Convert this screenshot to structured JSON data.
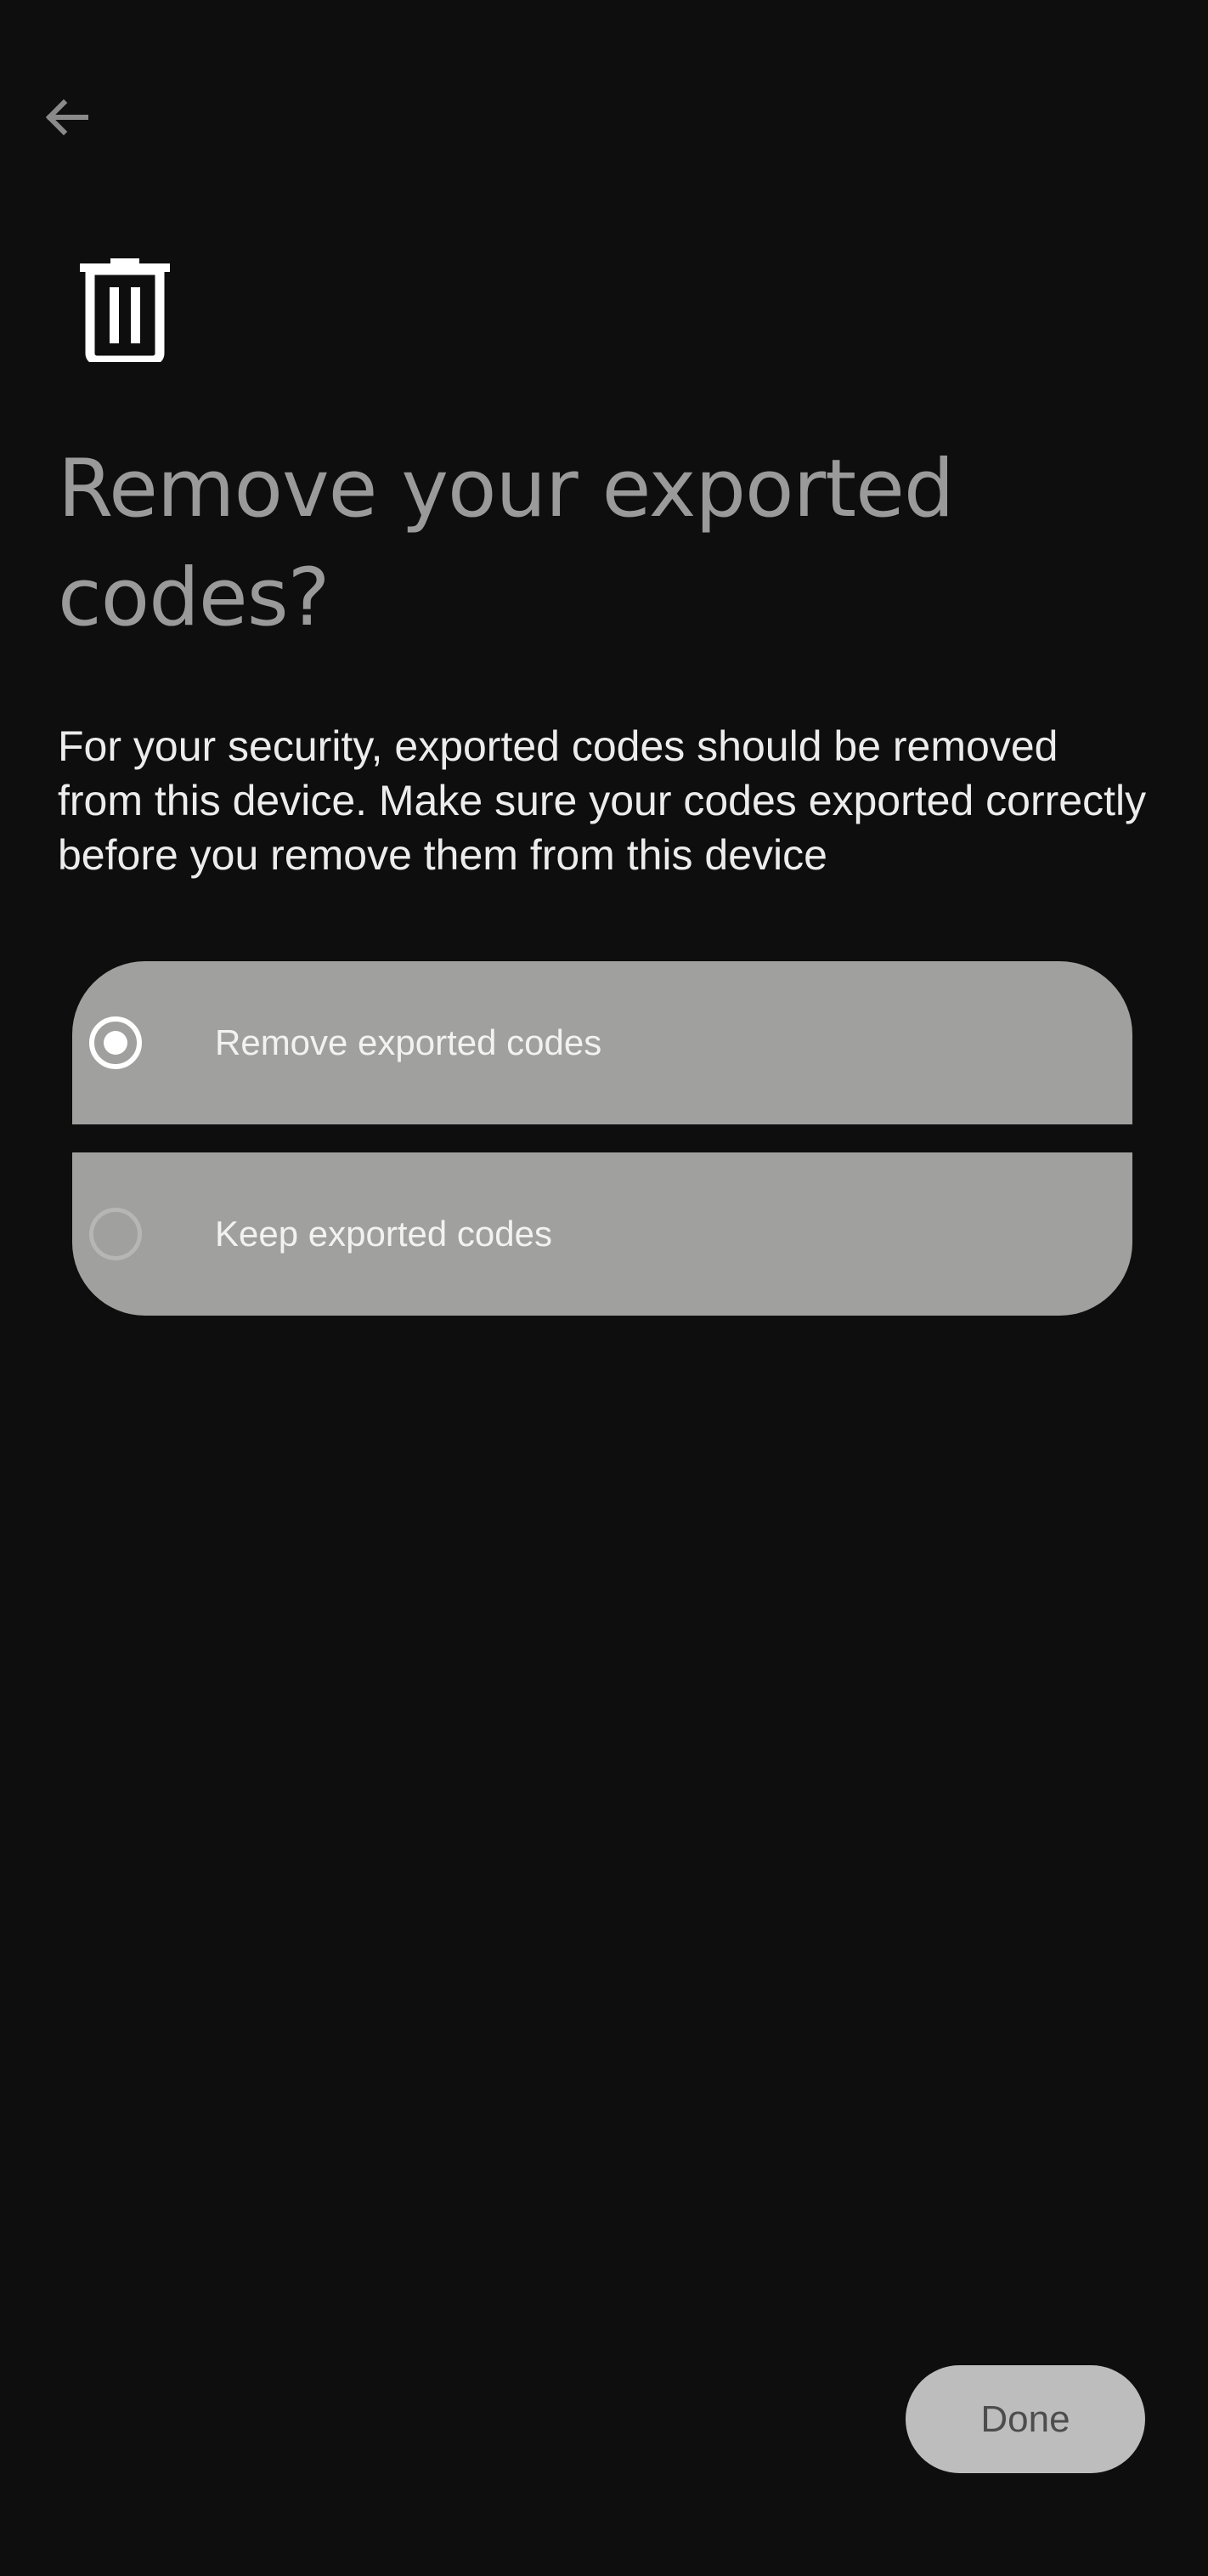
{
  "header": {
    "back_icon": "arrow-back-icon",
    "trash_icon": "trash-icon"
  },
  "main": {
    "title": "Remove your exported codes?",
    "description": "For your security, exported codes should be removed from this device. Make sure your codes exported correctly before you remove them from this device"
  },
  "options": [
    {
      "label": "Remove exported codes",
      "selected": true
    },
    {
      "label": "Keep exported codes",
      "selected": false
    }
  ],
  "footer": {
    "done_label": "Done"
  },
  "colors": {
    "background": "#0e0e0e",
    "option_background": "#a0a09e",
    "button_background": "#bdbdbd"
  }
}
